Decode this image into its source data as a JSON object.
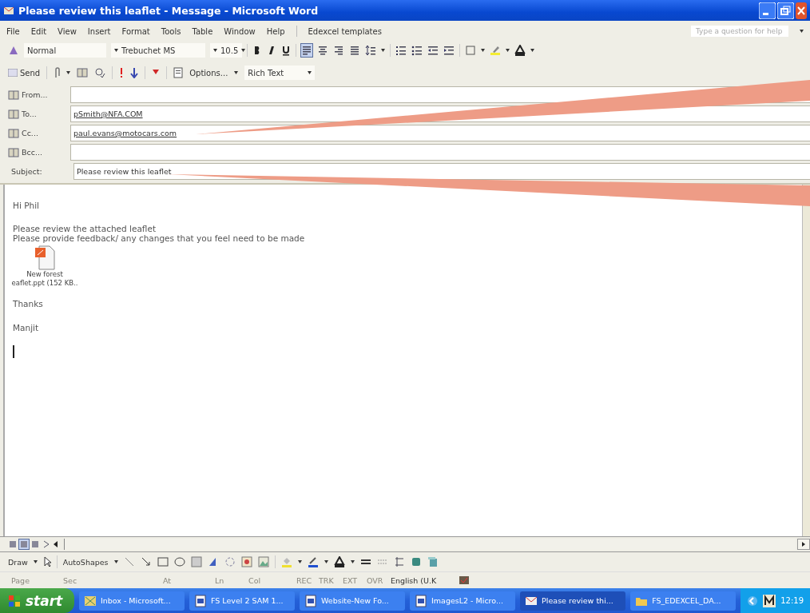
{
  "window": {
    "title": "Please review this leaflet - Message - Microsoft Word"
  },
  "menu": [
    "File",
    "Edit",
    "View",
    "Insert",
    "Format",
    "Tools",
    "Table",
    "Window",
    "Help",
    "Edexcel templates"
  ],
  "help_box": {
    "placeholder": "Type a question for help"
  },
  "formatting": {
    "style": "Normal",
    "font": "Trebuchet MS",
    "size": "10.5",
    "alignments": [
      {
        "selected": true
      },
      {
        "selected": false
      },
      {
        "selected": false
      },
      {
        "selected": false
      }
    ]
  },
  "send_toolbar": {
    "send": "Send",
    "options": "Options...",
    "format": "Rich Text"
  },
  "header_fields": [
    {
      "label": "From...",
      "kind": "address"
    },
    {
      "label": "To...",
      "kind": "address",
      "value": "pSmith@NFA.COM"
    },
    {
      "label": "Cc...",
      "kind": "address",
      "value": "paul.evans@motocars.com"
    },
    {
      "label": "Bcc...",
      "kind": "address"
    },
    {
      "label": "Subject:",
      "kind": "subject",
      "value": "Please review this leaflet"
    }
  ],
  "body": {
    "greeting": "Hi Phil",
    "lines": [
      "Please review the attached leaflet",
      "Please provide feedback/ any changes that you feel need to be made"
    ],
    "attachment": {
      "name_lines": [
        "New forest",
        "eaflet.ppt (152 KB.."
      ]
    },
    "closing": "Thanks",
    "signature": "Manjit"
  },
  "view_buttons": [
    {
      "selected": false
    },
    {
      "selected": true
    },
    {
      "selected": false
    },
    {
      "selected": false
    }
  ],
  "drawing_toolbar": {
    "draw": "Draw",
    "autoshapes": "AutoShapes"
  },
  "status_bar": [
    {
      "text": "Page",
      "dimmed": true
    },
    {
      "text": "Sec",
      "dimmed": true
    },
    {
      "text": "At",
      "dimmed": true
    },
    {
      "text": "Ln",
      "dimmed": true
    },
    {
      "text": "Col",
      "dimmed": true
    },
    {
      "text": "REC",
      "dimmed": true
    },
    {
      "text": "TRK",
      "dimmed": true
    },
    {
      "text": "EXT",
      "dimmed": true
    },
    {
      "text": "OVR",
      "dimmed": true
    },
    {
      "text": "English (U.K",
      "dimmed": false
    }
  ],
  "taskbar": {
    "start": "start",
    "tasks": [
      {
        "label": "Inbox - Microsoft...",
        "kind": "mail",
        "selected": false
      },
      {
        "label": "FS Level 2 SAM 1...",
        "kind": "document",
        "selected": false
      },
      {
        "label": "Website-New Fo...",
        "kind": "document",
        "selected": false
      },
      {
        "label": "ImagesL2 - Micro...",
        "kind": "document",
        "selected": false
      },
      {
        "label": "Please review thi...",
        "kind": "message",
        "selected": true
      },
      {
        "label": "FS_EDEXCEL_DA...",
        "kind": "folder",
        "selected": false
      }
    ],
    "clock": "12:19"
  }
}
